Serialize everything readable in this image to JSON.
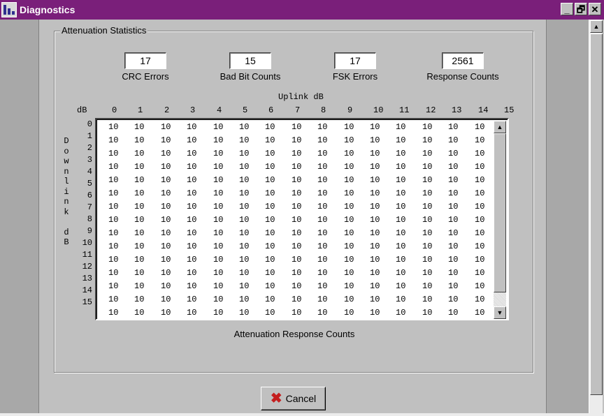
{
  "window": {
    "title": "Diagnostics",
    "controls": {
      "minimize": "_",
      "maximize": "🗗",
      "close": "✕"
    }
  },
  "group": {
    "title": "Attenuation Statistics"
  },
  "stats": [
    {
      "label": "CRC Errors",
      "value": "17"
    },
    {
      "label": "Bad Bit Counts",
      "value": "15"
    },
    {
      "label": "FSK Errors",
      "value": "17"
    },
    {
      "label": "Response Counts",
      "value": "2561"
    }
  ],
  "grid": {
    "uplink_title": "Uplink dB",
    "corner_label": "dB",
    "column_headers": [
      "0",
      "1",
      "2",
      "3",
      "4",
      "5",
      "6",
      "7",
      "8",
      "9",
      "10",
      "11",
      "12",
      "13",
      "14",
      "15"
    ],
    "row_headers": [
      "0",
      "1",
      "2",
      "3",
      "4",
      "5",
      "6",
      "7",
      "8",
      "9",
      "10",
      "11",
      "12",
      "13",
      "14",
      "15"
    ],
    "downlink_letters": [
      "D",
      "o",
      "w",
      "n",
      "l",
      "i",
      "n",
      "k",
      "",
      "d",
      "B"
    ],
    "cell_value": "10",
    "caption": "Attenuation Response Counts"
  },
  "buttons": {
    "cancel_label": "Cancel"
  },
  "icons": {
    "cancel": "x-icon",
    "app": "app-icon"
  },
  "colors": {
    "titlebar": "#7a1f7a",
    "face": "#c0c0c0",
    "cancel_icon": "#c41e1e"
  }
}
